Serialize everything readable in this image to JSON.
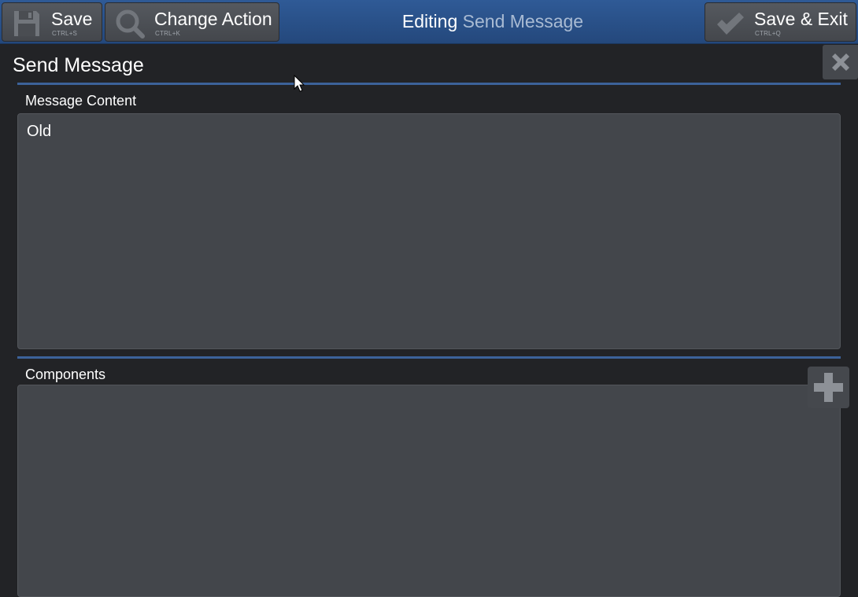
{
  "toolbar": {
    "save": {
      "label": "Save",
      "shortcut": "CTRL+S",
      "icon": "floppy-disk-icon"
    },
    "change_action": {
      "label": "Change Action",
      "shortcut": "CTRL+K",
      "icon": "magnifier-icon"
    },
    "save_exit": {
      "label": "Save & Exit",
      "shortcut": "CTRL+Q",
      "icon": "checkmark-icon"
    },
    "title_prefix": "Editing",
    "title_target": "Send Message"
  },
  "panel": {
    "title": "Send Message",
    "close_icon": "close-icon",
    "message_content": {
      "label": "Message Content",
      "value": "Old"
    },
    "components": {
      "label": "Components",
      "value": "",
      "add_icon": "plus-icon"
    }
  },
  "colors": {
    "toolbar": "#2f5a96",
    "background": "#222326",
    "field": "#43464b",
    "divider": "#3c6299",
    "title_accent": "#a9bbd3"
  }
}
